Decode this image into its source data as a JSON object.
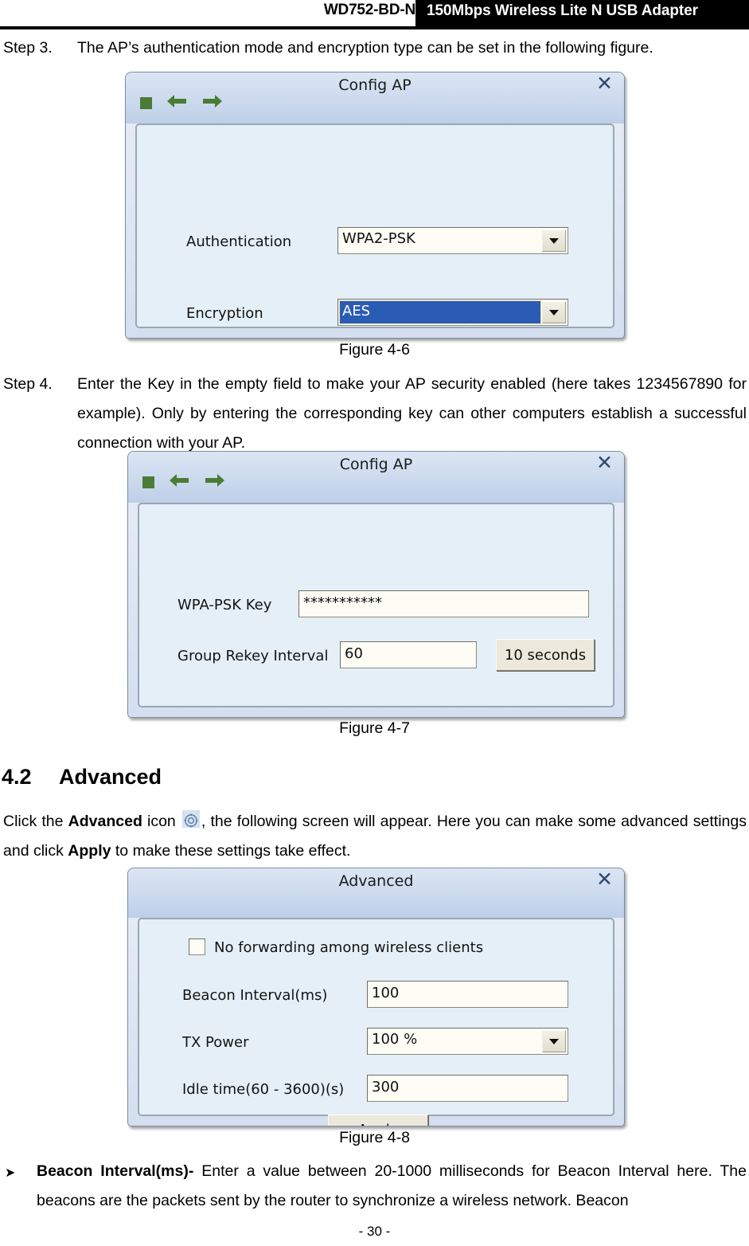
{
  "header": {
    "model": "WD752-BD-N",
    "product": "150Mbps Wireless Lite N USB Adapter"
  },
  "footer": {
    "page_number": "- 30 -"
  },
  "steps": {
    "step3_label": "Step 3.",
    "step3_text": "The AP’s authentication mode and encryption type can be set in the following figure.",
    "step4_label": "Step 4.",
    "step4_text": "Enter the Key in the empty field to make your AP security enabled (here takes 1234567890 for example). Only by entering the corresponding key can other computers establish a successful connection with your AP."
  },
  "figures": {
    "fig46_caption": "Figure 4-6",
    "fig47_caption": "Figure 4-7",
    "fig48_caption": "Figure 4-8"
  },
  "dialog_config_ap_1": {
    "title": "Config AP",
    "close_label": "✕",
    "toolbar": {
      "stop_icon": "stop-square-icon",
      "back_icon": "back-arrow-icon",
      "forward_icon": "forward-arrow-icon"
    },
    "fields": {
      "authentication_label": "Authentication",
      "authentication_value": "WPA2-PSK",
      "encryption_label": "Encryption",
      "encryption_value": "AES"
    }
  },
  "dialog_config_ap_2": {
    "title": "Config AP",
    "close_label": "✕",
    "fields": {
      "wpa_psk_key_label": "WPA-PSK Key",
      "wpa_psk_key_value": "***********",
      "group_rekey_label": "Group Rekey Interval",
      "group_rekey_value": "60",
      "rekey_unit_button": "10 seconds"
    }
  },
  "dialog_advanced": {
    "title": "Advanced",
    "close_label": "✕",
    "fields": {
      "no_forwarding_label": "No forwarding among wireless clients",
      "no_forwarding_checked": false,
      "beacon_interval_label": "Beacon Interval(ms)",
      "beacon_interval_value": "100",
      "tx_power_label": "TX Power",
      "tx_power_value": "100 %",
      "idle_time_label": "Idle time(60 - 3600)(s)",
      "idle_time_value": "300",
      "apply_button": "Apply"
    }
  },
  "section": {
    "number": "4.2",
    "title": "Advanced",
    "paragraph_before_icon": "Click the ",
    "paragraph_bold_advanced": "Advanced",
    "paragraph_icon_word": " icon ",
    "paragraph_after_icon": ", the following screen will appear. Here you can make some advanced settings and click ",
    "paragraph_bold_apply": "Apply",
    "paragraph_tail": " to make these settings take effect."
  },
  "bullet": {
    "marker": "➤",
    "term": "Beacon Interval(ms)-",
    "text": " Enter a value between 20-1000 milliseconds for Beacon Interval here. The beacons are the packets sent by the router to synchronize a wireless network. Beacon"
  },
  "colors": {
    "header_band": "#000000",
    "dialog_title_bar": "#cfdcef",
    "dialog_body": "#e5eff7",
    "selection_blue": "#2a5bb5",
    "toolbar_green": "#4a7c35",
    "button_face": "#ece9dc"
  }
}
